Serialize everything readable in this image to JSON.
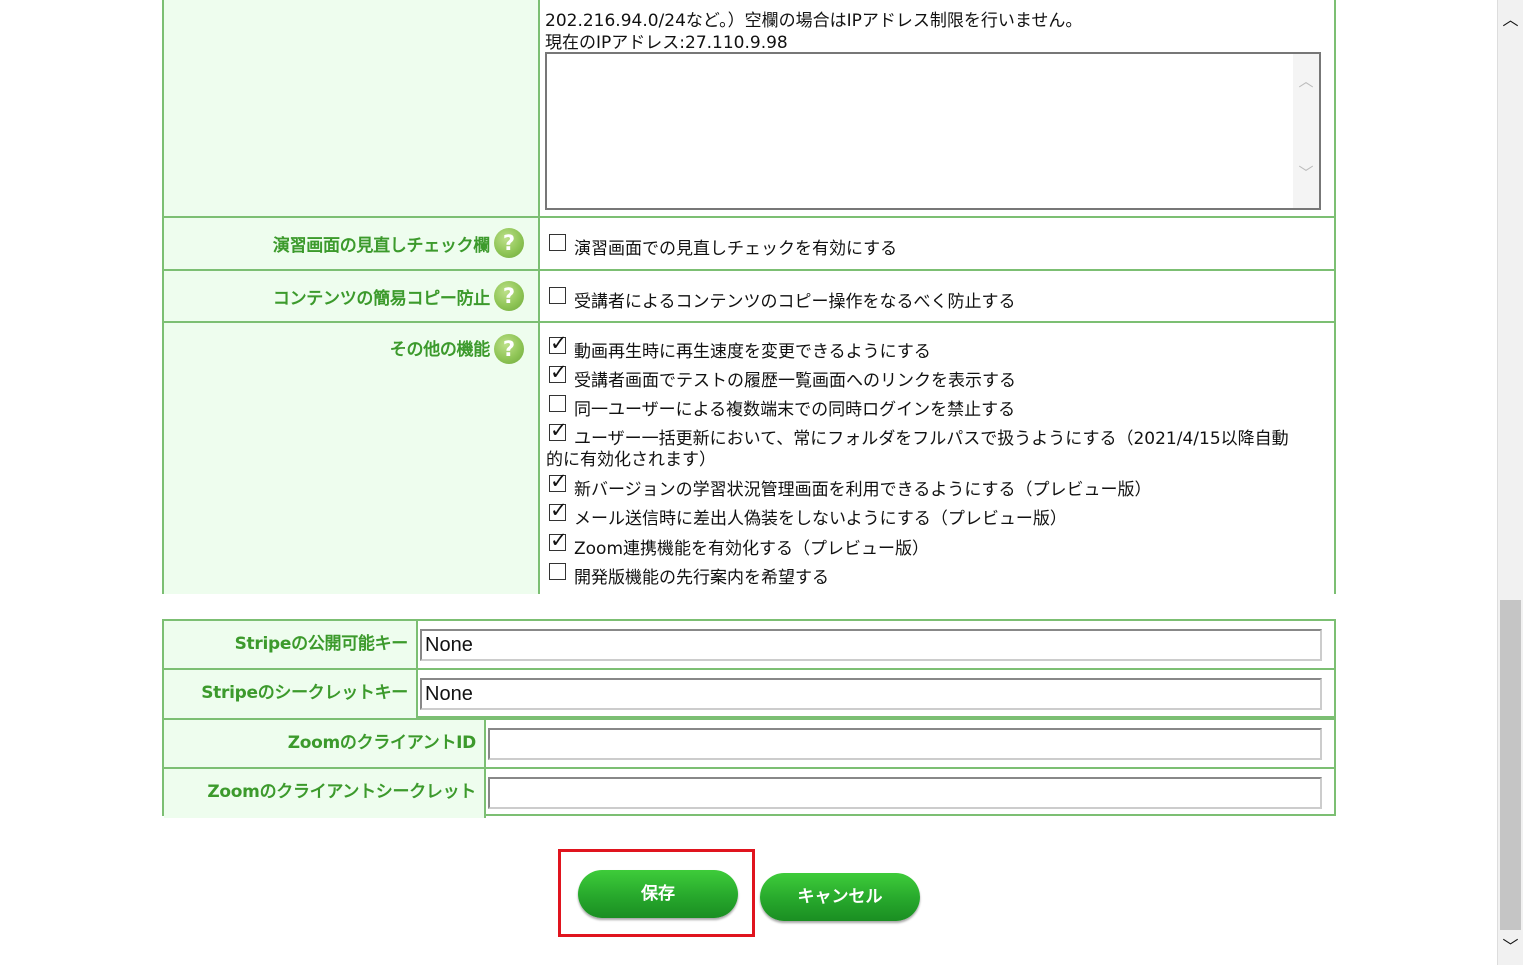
{
  "ip_row": {
    "line1": "202.216.94.0/24など。）空欄の場合はIPアドレス制限を行いません。",
    "line2_label": "現在のIPアドレス:",
    "line2_value": "27.110.9.98",
    "textarea_value": ""
  },
  "review_row": {
    "label": "演習画面の見直しチェック欄",
    "help": "?",
    "option": {
      "label": "演習画面での見直しチェックを有効にする",
      "checked": false
    }
  },
  "copy_row": {
    "label": "コンテンツの簡易コピー防止",
    "help": "?",
    "option": {
      "label": "受講者によるコンテンツのコピー操作をなるべく防止する",
      "checked": false
    }
  },
  "other_row": {
    "label": "その他の機能",
    "help": "?",
    "options": [
      {
        "label": "動画再生時に再生速度を変更できるようにする",
        "checked": true
      },
      {
        "label": "受講者画面でテストの履歴一覧画面へのリンクを表示する",
        "checked": true
      },
      {
        "label": "同一ユーザーによる複数端末での同時ログインを禁止する",
        "checked": false
      },
      {
        "label": "ユーザー一括更新において、常にフォルダをフルパスで扱うようにする（2021/4/15以降自動",
        "label_cont": "的に有効化されます）",
        "checked": true
      },
      {
        "label": "新バージョンの学習状況管理画面を利用できるようにする（プレビュー版）",
        "checked": true
      },
      {
        "label": "メール送信時に差出人偽装をしないようにする（プレビュー版）",
        "checked": true
      },
      {
        "label": "Zoom連携機能を有効化する（プレビュー版）",
        "checked": true
      },
      {
        "label": "開発版機能の先行案内を希望する",
        "checked": false
      }
    ]
  },
  "stripe": {
    "public_key_label": "Stripeの公開可能キー",
    "public_key_value": "None",
    "secret_key_label": "Stripeのシークレットキー",
    "secret_key_value": "None"
  },
  "zoom": {
    "client_id_label": "ZoomのクライアントID",
    "client_id_value": "",
    "client_secret_label": "Zoomのクライアントシークレット",
    "client_secret_value": ""
  },
  "buttons": {
    "save": "保存",
    "cancel": "キャンセル"
  },
  "icons": {
    "help": "help-question-icon",
    "scroll_up": "chevron-up-icon",
    "scroll_down": "chevron-down-icon"
  },
  "colors": {
    "accent_green": "#3c9a2c",
    "label_bg": "#eefdee",
    "border_green": "#7cbf73",
    "highlight_red": "#e0141e",
    "button_green": "#27a82c"
  }
}
